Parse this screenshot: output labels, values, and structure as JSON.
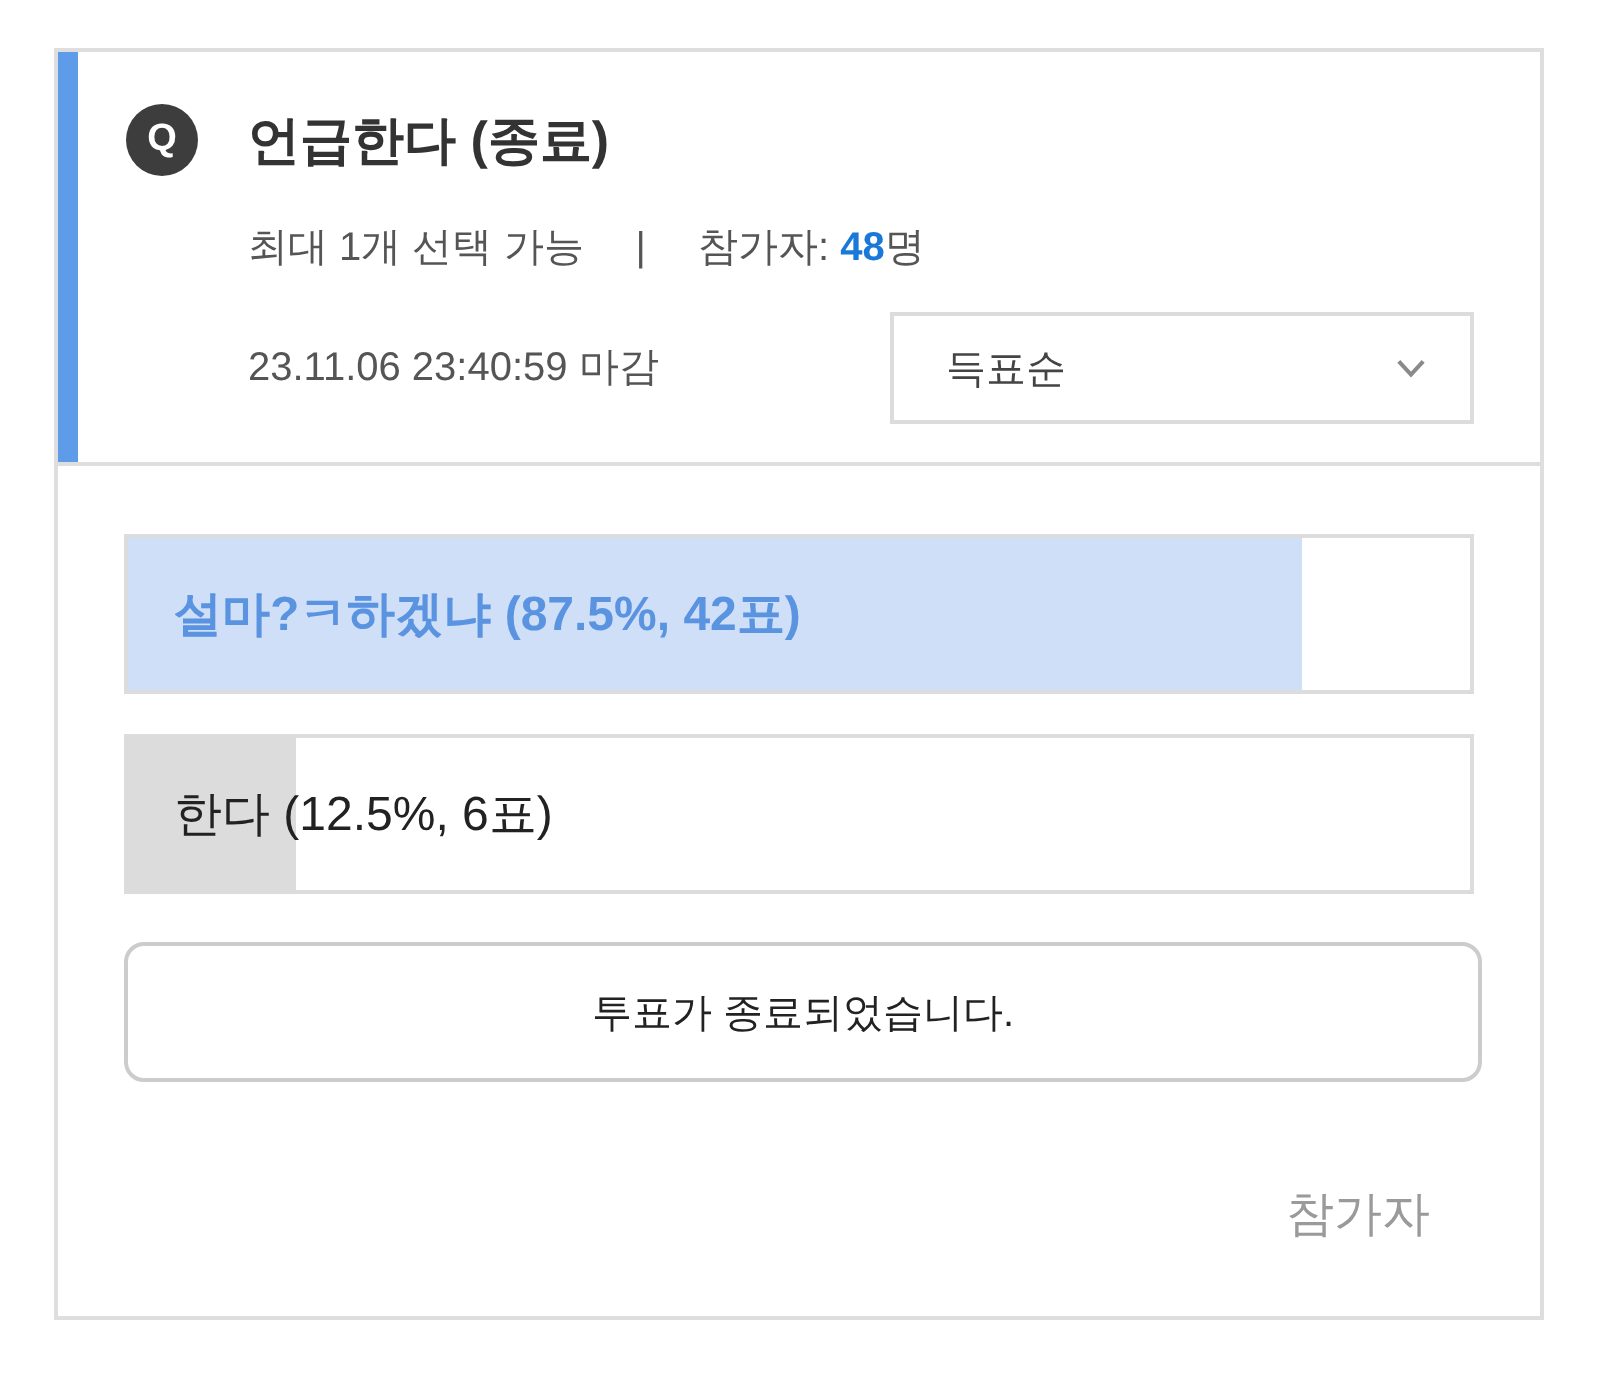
{
  "poll": {
    "badge": "Q",
    "title": "언급한다 (종료)",
    "limit": "최대 1개 선택 가능",
    "separator": "|",
    "participants": "참가자: **48**명",
    "deadline": "23.11.06 23:40:59 마감",
    "sort": {
      "value": "득표순"
    }
  },
  "options": [
    {
      "label": "설마?ㅋ하겠냐 (87.5%, 42표)",
      "level": 0.875,
      "selected": true
    },
    {
      "label": "한다 (12.5%, 6표)",
      "level": 0.125,
      "selected": false
    }
  ],
  "status_button": {
    "label": "투표가 종료되었습니다."
  },
  "participants_link": {
    "label": "참가자"
  }
}
